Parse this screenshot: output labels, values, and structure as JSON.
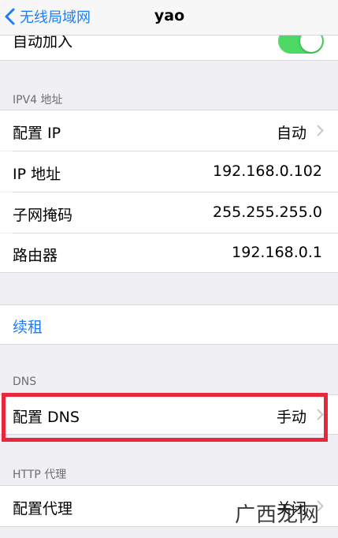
{
  "navbar": {
    "back_label": "无线局域网",
    "title": "yao"
  },
  "auto_join": {
    "label": "自动加入",
    "toggle_on": true,
    "toggle_color": "#4cd964"
  },
  "ipv4": {
    "header": "IPV4 地址",
    "rows": [
      {
        "label": "配置 IP",
        "value": "自动"
      },
      {
        "label": "IP 地址",
        "value": "192.168.0.102"
      },
      {
        "label": "子网掩码",
        "value": "255.255.255.0"
      },
      {
        "label": "路由器",
        "value": "192.168.0.1"
      }
    ]
  },
  "renew": {
    "label": "续租"
  },
  "dns": {
    "header": "DNS",
    "label": "配置 DNS",
    "value": "手动"
  },
  "http_proxy": {
    "header": "HTTP 代理",
    "label": "配置代理",
    "value": "关闭"
  },
  "watermark": "广西龙网",
  "colors": {
    "accent": "#1d7ef9",
    "highlight": "#e8283a",
    "background": "#efeff4"
  }
}
